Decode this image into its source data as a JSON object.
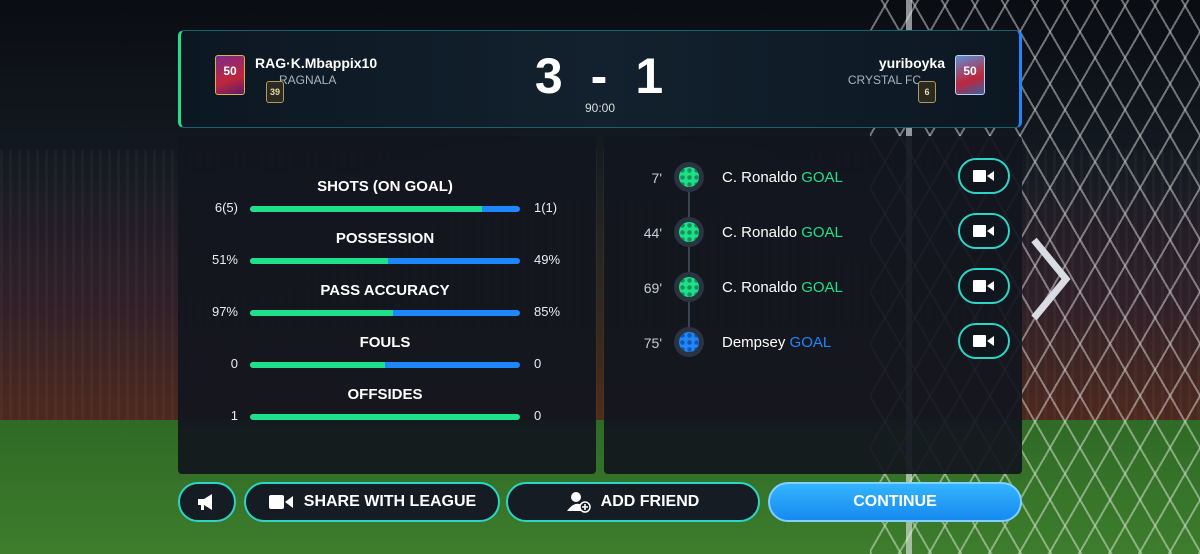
{
  "home": {
    "player_name": "RAG·K.Mbappix10",
    "club": "RAGNALA",
    "card_rating": "50",
    "level": "39",
    "accent_color": "#1ee08a"
  },
  "away": {
    "player_name": "yuriboyka",
    "club": "CRYSTAL FC",
    "card_rating": "50",
    "level": "6",
    "accent_color": "#1e86ff"
  },
  "score": {
    "home": "3",
    "separator": "-",
    "away": "1",
    "clock": "90:00"
  },
  "stats": [
    {
      "label": "SHOTS (ON GOAL)",
      "home": "6(5)",
      "away": "1(1)",
      "home_share": 0.86
    },
    {
      "label": "POSSESSION",
      "home": "51%",
      "away": "49%",
      "home_share": 0.51
    },
    {
      "label": "PASS ACCURACY",
      "home": "97%",
      "away": "85%",
      "home_share": 0.53
    },
    {
      "label": "FOULS",
      "home": "0",
      "away": "0",
      "home_share": 0.5
    },
    {
      "label": "OFFSIDES",
      "home": "1",
      "away": "0",
      "home_share": 1.0
    }
  ],
  "events": [
    {
      "minute": "7'",
      "player": "C. Ronaldo",
      "type": "GOAL",
      "team": "home",
      "icon": "ball-icon"
    },
    {
      "minute": "44'",
      "player": "C. Ronaldo",
      "type": "GOAL",
      "team": "home",
      "icon": "ball-icon"
    },
    {
      "minute": "69'",
      "player": "C. Ronaldo",
      "type": "GOAL",
      "team": "home",
      "icon": "ball-icon"
    },
    {
      "minute": "75'",
      "player": "Dempsey",
      "type": "GOAL",
      "team": "away",
      "icon": "ball-icon"
    }
  ],
  "buttons": {
    "share": "SHARE WITH LEAGUE",
    "add_friend": "ADD FRIEND",
    "continue": "CONTINUE"
  },
  "colors": {
    "home": "#1ee08a",
    "away": "#1e86ff",
    "button_outline": "#2ad6c8",
    "continue": "#168af0"
  }
}
